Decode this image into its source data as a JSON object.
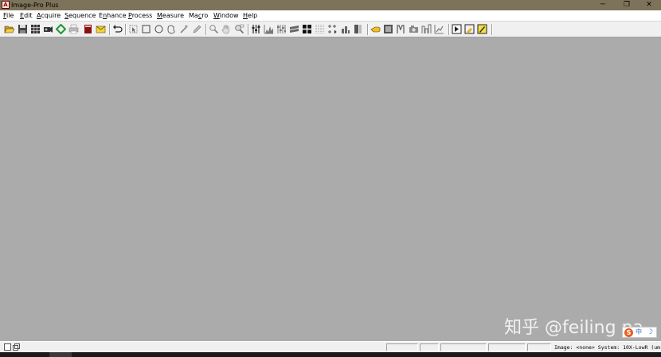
{
  "window": {
    "title": "Image-Pro Plus",
    "app_icon_glyph": "A",
    "controls": {
      "minimize": "─",
      "maximize": "❐",
      "close": "✕"
    }
  },
  "menu": [
    {
      "name": "file",
      "pre": "",
      "u": "F",
      "post": "ile"
    },
    {
      "name": "edit",
      "pre": "",
      "u": "E",
      "post": "dit"
    },
    {
      "name": "acquire",
      "pre": "",
      "u": "A",
      "post": "cquire"
    },
    {
      "name": "sequence",
      "pre": "",
      "u": "S",
      "post": "equence"
    },
    {
      "name": "enhance",
      "pre": "E",
      "u": "n",
      "post": "hance"
    },
    {
      "name": "process",
      "pre": "",
      "u": "P",
      "post": "rocess"
    },
    {
      "name": "measure",
      "pre": "",
      "u": "M",
      "post": "easure"
    },
    {
      "name": "macro",
      "pre": "Ma",
      "u": "c",
      "post": "ro"
    },
    {
      "name": "window",
      "pre": "",
      "u": "W",
      "post": "indow"
    },
    {
      "name": "help",
      "pre": "",
      "u": "H",
      "post": "elp"
    }
  ],
  "toolbar_icons": [
    "open-folder-icon",
    "save-icon",
    "grid-icon",
    "camera-acquire-icon",
    "cycle-icon",
    "print-icon",
    "book-icon",
    "mail-icon",
    "undo-icon",
    "select-pointer-icon",
    "rectangle-aoi-icon",
    "ellipse-aoi-icon",
    "irregular-aoi-icon",
    "magic-wand-icon",
    "pen-icon",
    "zoom-icon",
    "hand-icon",
    "zoom-region-icon",
    "contrast-icon",
    "histogram-icon",
    "equalize-icon",
    "filter-icon",
    "segment-icon",
    "dotted-grid-icon",
    "arrows-icon",
    "bar-chart-icon",
    "vertical-bar-icon",
    "pointer-hand-icon",
    "image-window-icon",
    "count-icon",
    "label-icon",
    "camera-icon",
    "calibration-icon",
    "measure-region-icon",
    "macro-run-icon",
    "macro-record-icon",
    "macro-edit-icon"
  ],
  "status": {
    "text": "Image: <none> System: 10X-LowR (um)"
  },
  "watermark": "知乎 @feiling na",
  "ime": {
    "logo": "S",
    "mode": "中",
    "moon": "☽"
  },
  "colors": {
    "titlebar": "#7d735a",
    "workspace": "#ababab",
    "toolbar": "#f0f0f0"
  }
}
